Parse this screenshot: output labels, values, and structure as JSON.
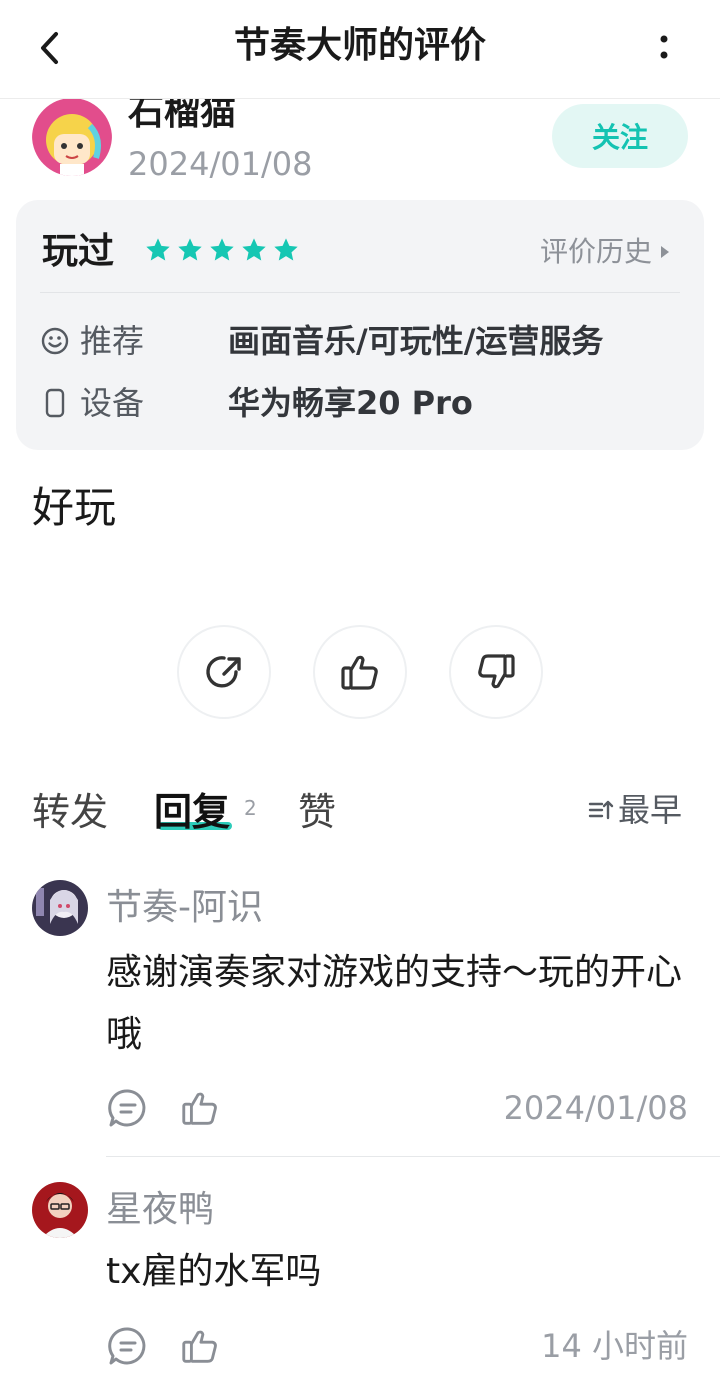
{
  "header": {
    "title": "节奏大师的评价",
    "back_icon": "chevron-left-icon",
    "more_icon": "more-vertical-icon"
  },
  "user": {
    "name": "石榴猫",
    "date": "2024/01/08",
    "follow_label": "关注"
  },
  "card": {
    "played_label": "玩过",
    "rating": 5,
    "star_color": "#16c7b3",
    "history_label": "评价历史",
    "recommend_label": "推荐",
    "recommend_value": "画面音乐/可玩性/运营服务",
    "device_label": "设备",
    "device_value": "华为畅享20 Pro"
  },
  "review": {
    "text": "好玩"
  },
  "tabs": {
    "forward": "转发",
    "reply": "回复",
    "reply_count": "2",
    "likes": "赞",
    "sort": "最早"
  },
  "comments": [
    {
      "name": "节奏-阿识",
      "text": "感谢演奏家对游戏的支持～玩的开心哦",
      "time": "2024/01/08"
    },
    {
      "name": "星夜鸭",
      "text": "tx雇的水军吗",
      "time": "14 小时前"
    }
  ],
  "colors": {
    "accent": "#16c7b3",
    "follow_bg": "#e3f7f4",
    "muted": "#9a9ea5"
  }
}
